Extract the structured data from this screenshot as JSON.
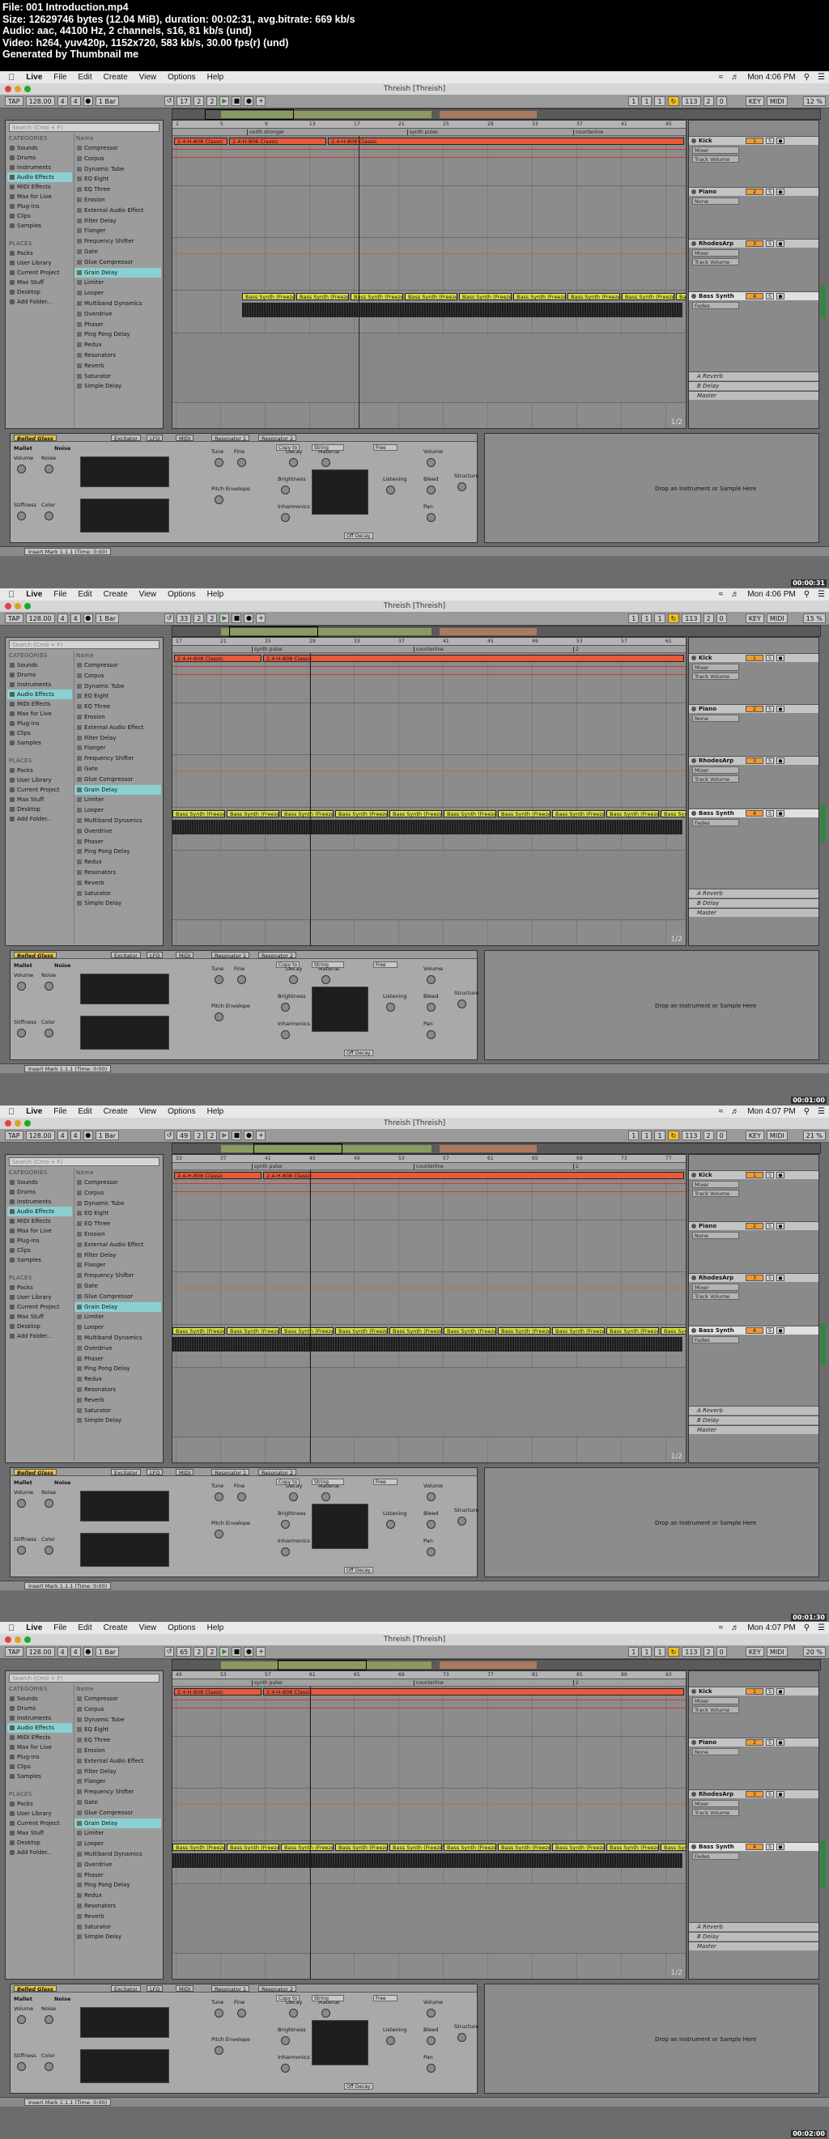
{
  "header": {
    "lines": [
      "File: 001 Introduction.mp4",
      "Size: 12629746 bytes (12.04 MiB), duration: 00:02:31, avg.bitrate: 669 kb/s",
      "Audio: aac, 44100 Hz, 2 channels, s16, 81 kb/s (und)",
      "Video: h264, yuv420p, 1152x720, 583 kb/s, 30.00 fps(r) (und)",
      "Generated by Thumbnail me"
    ]
  },
  "app": {
    "title": "Threish  [Threish]",
    "menu": [
      "Live",
      "File",
      "Edit",
      "Create",
      "View",
      "Options",
      "Help"
    ],
    "tempo": "128.00",
    "signature_num": "4",
    "signature_den": "4",
    "quantize": "1 Bar",
    "loop_end": "113",
    "loop_len_a": "2",
    "loop_len_b": "0",
    "cpu_key": "KEY",
    "cpu_midi": "MIDI",
    "search_placeholder": "Search (Cmd + F)",
    "categories_header": "CATEGORIES",
    "places_header": "PLACES",
    "name_header": "Name",
    "categories": [
      "Sounds",
      "Drums",
      "Instruments",
      "Audio Effects",
      "MIDI Effects",
      "Max for Live",
      "Plug-ins",
      "Clips",
      "Samples"
    ],
    "places": [
      "Packs",
      "User Library",
      "Current Project",
      "Max Stuff",
      "Desktop",
      "Add Folder..."
    ],
    "effects": [
      "Compressor",
      "Corpus",
      "Dynamic Tube",
      "EQ Eight",
      "EQ Three",
      "Erosion",
      "External Audio Effect",
      "Filter Delay",
      "Flanger",
      "Frequency Shifter",
      "Gate",
      "Glue Compressor",
      "Grain Delay",
      "Limiter",
      "Looper",
      "Multiband Dynamics",
      "Overdrive",
      "Phaser",
      "Ping Pong Delay",
      "Redux",
      "Resonators",
      "Reverb",
      "Saturator",
      "Simple Delay"
    ],
    "tracks": [
      {
        "name": "Kick",
        "mixer": "Mixer",
        "param": "Track Volume"
      },
      {
        "name": "Piano",
        "mixer": "None",
        "param": ""
      },
      {
        "name": "RhodesArp",
        "mixer": "Mixer",
        "param": "Track Volume"
      },
      {
        "name": "Bass Synth",
        "mixer": "Fades",
        "param": ""
      }
    ],
    "returns": [
      "A Reverb",
      "B Delay",
      "Master"
    ],
    "track_numbers": [
      "1",
      "2",
      "3",
      "4"
    ],
    "kick_clip": "2.4-H-808 Classic",
    "bass_clip": "Bass Synth (Freeze)",
    "locators": [
      "north stronger",
      "synth pulse",
      "counterline"
    ],
    "locators_late": [
      "synth pulse",
      "counterline",
      "2"
    ],
    "page_hint": "1/2",
    "device": {
      "name": "Belled Glass",
      "chips": [
        "Excitator",
        "LFO",
        "MIDI",
        "Resonator 1",
        "Resonator 2"
      ],
      "mallet": "Mallet",
      "noise": "Noise",
      "labels": [
        "Volume",
        "Noise",
        "Stiffness",
        "Color",
        "Tune",
        "Fine",
        "Decay",
        "Material",
        "Volume",
        "Pitch Envelope",
        "Brightness",
        "Inharmonics",
        "Listening",
        "Bleed",
        "Pan",
        "Structure"
      ],
      "copy": "Copy to",
      "string": "String",
      "free": "Free",
      "off_decay": "Off Decay"
    },
    "dropzone_text": "Drop an Instrument or Sample Here",
    "status_text": "Insert Mark 1.1.1 (Time: 0:00)"
  },
  "frames": [
    {
      "time": "Mon 4:06 PM",
      "bar": "17",
      "cpu": "12 %",
      "stamp": "00:00:31"
    },
    {
      "time": "Mon 4:06 PM",
      "bar": "33",
      "cpu": "15 %",
      "stamp": "00:01:00"
    },
    {
      "time": "Mon 4:07 PM",
      "bar": "49",
      "cpu": "21 %",
      "stamp": "00:01:30"
    },
    {
      "time": "Mon 4:07 PM",
      "bar": "65",
      "cpu": "20 %",
      "stamp": "00:02:00"
    }
  ]
}
